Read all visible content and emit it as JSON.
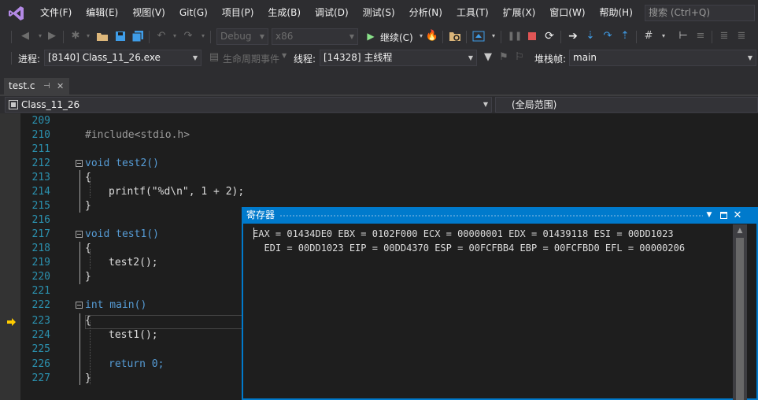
{
  "menu": {
    "items": [
      "文件(F)",
      "编辑(E)",
      "视图(V)",
      "Git(G)",
      "项目(P)",
      "生成(B)",
      "调试(D)",
      "测试(S)",
      "分析(N)",
      "工具(T)",
      "扩展(X)",
      "窗口(W)",
      "帮助(H)"
    ],
    "search_placeholder": "搜索 (Ctrl+Q)"
  },
  "toolbar": {
    "config_value": "Debug",
    "platform_value": "x86",
    "continue_label": "继续(C)"
  },
  "debug_location": {
    "process_label": "进程:",
    "process_value": "[8140] Class_11_26.exe",
    "lifecycle_label": "生命周期事件",
    "thread_label": "线程:",
    "thread_value": "[14328] 主线程",
    "stackframe_label": "堆栈帧:",
    "stackframe_value": "main"
  },
  "tabs": [
    {
      "label": "test.c",
      "pin": "⊣",
      "close": "✕"
    }
  ],
  "navbar": {
    "project": "Class_11_26",
    "scope": "(全局范围)"
  },
  "editor": {
    "lines": [
      {
        "num": "209",
        "text": ""
      },
      {
        "num": "210",
        "text": "#include<stdio.h>"
      },
      {
        "num": "211",
        "text": ""
      },
      {
        "num": "212",
        "text": "void test2()"
      },
      {
        "num": "213",
        "text": "{"
      },
      {
        "num": "214",
        "text": "printf(\"%d\\n\", 1 + 2);"
      },
      {
        "num": "215",
        "text": "}"
      },
      {
        "num": "216",
        "text": ""
      },
      {
        "num": "217",
        "text": "void test1()"
      },
      {
        "num": "218",
        "text": "{"
      },
      {
        "num": "219",
        "text": "test2();"
      },
      {
        "num": "220",
        "text": "}"
      },
      {
        "num": "221",
        "text": ""
      },
      {
        "num": "222",
        "text": "int main()"
      },
      {
        "num": "223",
        "text": "{"
      },
      {
        "num": "224",
        "text": "test1();"
      },
      {
        "num": "225",
        "text": ""
      },
      {
        "num": "226",
        "text": "return 0;"
      },
      {
        "num": "227",
        "text": "}"
      }
    ],
    "current_line": "223"
  },
  "registers_window": {
    "title": "寄存器",
    "line1": "EAX = 01434DE0 EBX = 0102F000 ECX = 00000001 EDX = 01439118 ESI = 00DD1023",
    "line2": "  EDI = 00DD1023 EIP = 00DD4370 ESP = 00FCFBB4 EBP = 00FCFBD0 EFL = 00000206"
  },
  "colors": {
    "accent": "#007acc",
    "line_number": "#2b91af",
    "keyword": "#569cd6",
    "string": "#d69d85",
    "number": "#b5cea8"
  }
}
